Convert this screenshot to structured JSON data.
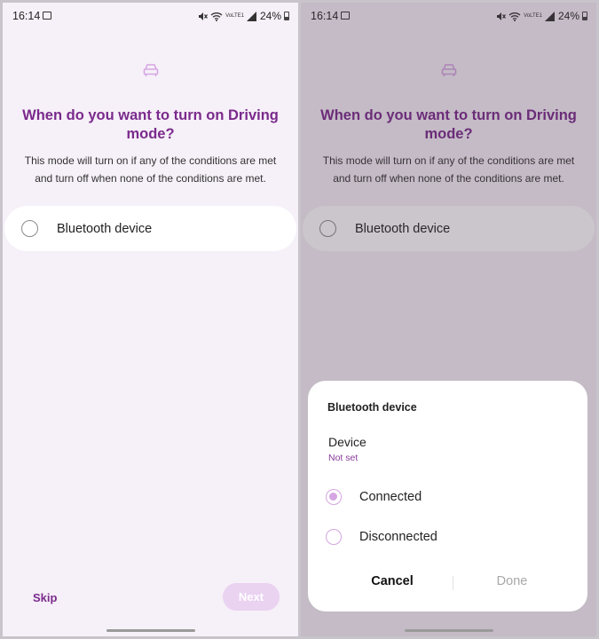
{
  "status_bar": {
    "time": "16:14",
    "battery": "24%",
    "network_label": "VoLTE1",
    "icons": [
      "gallery-icon",
      "mute-icon",
      "wifi-icon",
      "signal-icon",
      "battery-icon"
    ]
  },
  "setup": {
    "title": "When do you want to turn on Driving mode?",
    "description": "This mode will turn on if any of the conditions are met and turn off when none of the conditions are met.",
    "option_label": "Bluetooth device",
    "skip_label": "Skip",
    "next_label": "Next"
  },
  "dialog": {
    "title": "Bluetooth device",
    "device_label": "Device",
    "device_value": "Not set",
    "options": [
      {
        "label": "Connected",
        "selected": true
      },
      {
        "label": "Disconnected",
        "selected": false
      }
    ],
    "cancel_label": "Cancel",
    "done_label": "Done"
  },
  "colors": {
    "accent": "#7a2a8c",
    "background": "#f6f0f8",
    "next_disabled": "#ead2f1",
    "radio_accent": "#d6a6e3"
  }
}
